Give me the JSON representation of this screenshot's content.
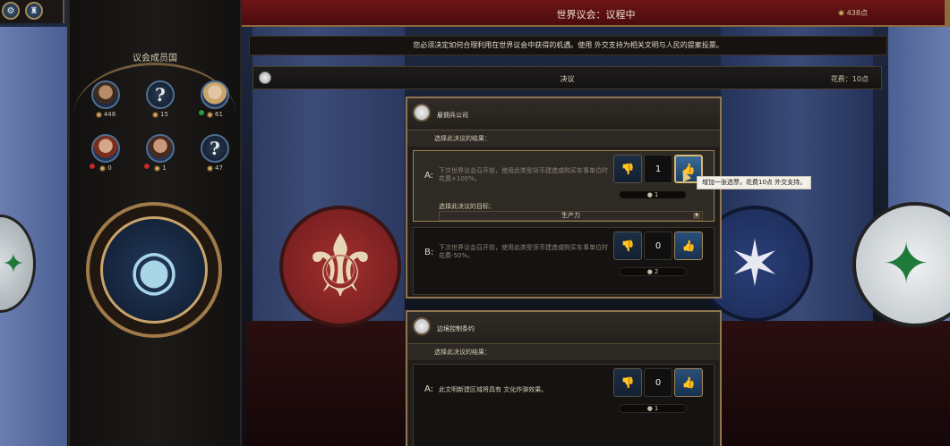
{
  "topbar": {
    "title": "世界议会：议程中",
    "points": "438点"
  },
  "info_text": "您必须决定如何合理利用在世界议会中获得的机遇。使用 外交支持为相关文明与人民的提案投票。",
  "section": {
    "label": "决议",
    "cost": "花费：10点"
  },
  "members_panel": {
    "title": "议会成员国",
    "members": [
      {
        "count": "448",
        "portrait": "leader-portrait",
        "status": "none"
      },
      {
        "count": "15",
        "portrait": "unknown",
        "status": "none"
      },
      {
        "count": "61",
        "portrait": "leader-portrait",
        "status": "green"
      },
      {
        "count": "0",
        "portrait": "leader-portrait",
        "status": "red"
      },
      {
        "count": "1",
        "portrait": "leader-portrait",
        "status": "red"
      },
      {
        "count": "47",
        "portrait": "unknown",
        "status": "none"
      }
    ]
  },
  "resolutions": [
    {
      "name": "雇佣兵公司",
      "choose_label": "选择此决议的结果：",
      "options": [
        {
          "letter": "A:",
          "desc": "下次世界议会召开前，使用此类型货币建造或购买车事单位时花费+100%。",
          "count": "1",
          "tally": "1",
          "target_label": "选择此决议的目标：",
          "target_value": "生产力"
        },
        {
          "letter": "B:",
          "desc": "下次世界议会召开前，使用此类型货币建造或购买车事单位时花费-50%。",
          "count": "0",
          "tally": "2"
        }
      ]
    },
    {
      "name": "边境控制条约",
      "choose_label": "选择此决议的结果：",
      "options": [
        {
          "letter": "A:",
          "desc": "此文明新建区域将具有 文化炸弹效果。",
          "count": "0",
          "tally": "1"
        }
      ]
    }
  ],
  "tooltip": "增加一张选票，花费10点 外交支持。",
  "icons": {
    "favor": "diplomatic-favor-icon",
    "thumbs_down": "👎",
    "thumbs_up": "👍",
    "question": "?",
    "caret": "▼"
  }
}
